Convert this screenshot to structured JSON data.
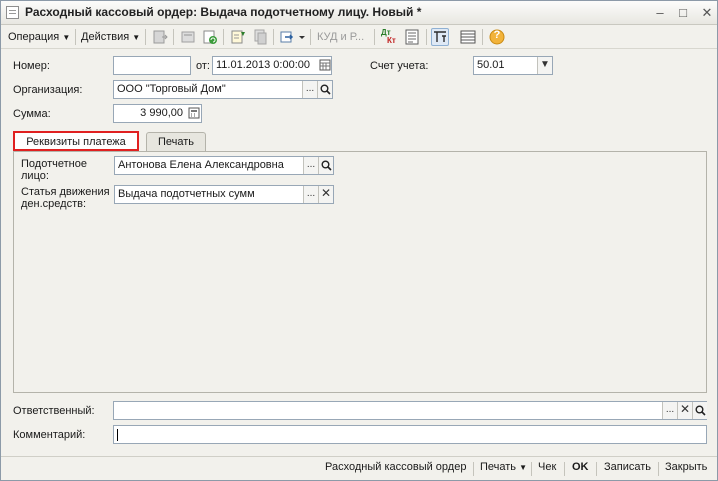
{
  "window": {
    "title": "Расходный кассовый ордер: Выдача подотчетному лицу. Новый *"
  },
  "toolbar": {
    "operation": "Операция",
    "actions": "Действия",
    "kud": "КУД и Р...",
    "dt_label": "Дт",
    "kt_label": "Кт",
    "help": "?"
  },
  "form": {
    "number_label": "Номер:",
    "number_value": "",
    "date_label": "от:",
    "date_value": "11.01.2013  0:00:00",
    "account_label": "Счет учета:",
    "account_value": "50.01",
    "org_label": "Организация:",
    "org_value": "ООО \"Торговый Дом\"",
    "sum_label": "Сумма:",
    "sum_value": "3 990,00"
  },
  "tabs": [
    {
      "label": "Реквизиты платежа",
      "active": true
    },
    {
      "label": "Печать",
      "active": false
    }
  ],
  "payment": {
    "person_label": "Подотчетное лицо:",
    "person_value": "Антонова Елена Александровна",
    "cashflow_label": "Статья движения ден.средств:",
    "cashflow_value": "Выдача подотчетных сумм"
  },
  "bottom": {
    "responsible_label": "Ответственный:",
    "responsible_value": "",
    "comment_label": "Комментарий:",
    "comment_value": ""
  },
  "statusbar": {
    "doc": "Расходный кассовый ордер",
    "print": "Печать",
    "check": "Чек",
    "ok": "OK",
    "save": "Записать",
    "close": "Закрыть"
  },
  "colors": {
    "tab_highlight": "#e02020",
    "background": "#f2f1ec",
    "field_border": "#98a7b6"
  }
}
